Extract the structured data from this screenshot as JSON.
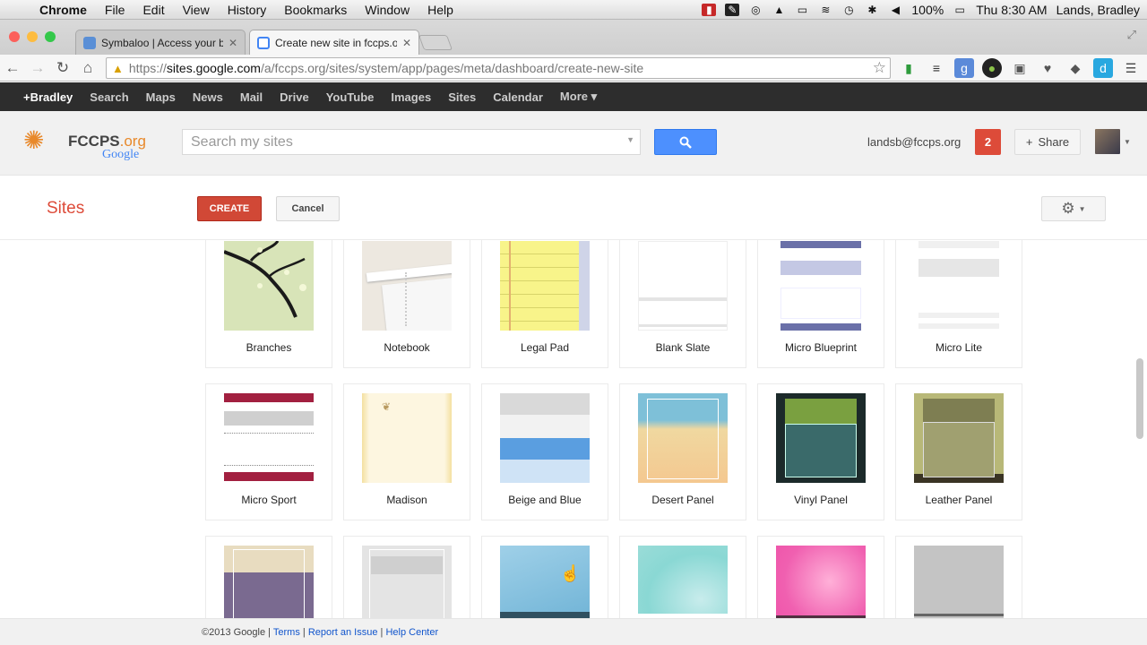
{
  "menubar": {
    "app": "Chrome",
    "items": [
      "File",
      "Edit",
      "View",
      "History",
      "Bookmarks",
      "Window",
      "Help"
    ],
    "battery": "100%",
    "clock": "Thu 8:30 AM",
    "user": "Lands, Bradley"
  },
  "tabs": [
    {
      "title": "Symbaloo | Access your bo",
      "active": false
    },
    {
      "title": "Create new site in fccps.or",
      "active": true
    }
  ],
  "omnibox": {
    "proto": "https://",
    "host": "sites.google.com",
    "path": "/a/fccps.org/sites/system/app/pages/meta/dashboard/create-new-site"
  },
  "gbar": {
    "items": [
      "+Bradley",
      "Search",
      "Maps",
      "News",
      "Mail",
      "Drive",
      "YouTube",
      "Images",
      "Sites",
      "Calendar",
      "More ▾"
    ]
  },
  "header": {
    "logo_main": "FCCPS",
    "logo_org": ".org",
    "logo_google": "Google",
    "search_placeholder": "Search my sites",
    "account": "landsb@fccps.org",
    "notifications": "2",
    "share": "Share"
  },
  "actions": {
    "title": "Sites",
    "create": "CREATE",
    "cancel": "Cancel"
  },
  "themes": [
    {
      "name": "Branches"
    },
    {
      "name": "Notebook"
    },
    {
      "name": "Legal Pad"
    },
    {
      "name": "Blank Slate"
    },
    {
      "name": "Micro Blueprint"
    },
    {
      "name": "Micro Lite"
    },
    {
      "name": "Micro Sport"
    },
    {
      "name": "Madison"
    },
    {
      "name": "Beige and Blue"
    },
    {
      "name": "Desert Panel"
    },
    {
      "name": "Vinyl Panel"
    },
    {
      "name": "Leather Panel"
    },
    {
      "name": ""
    },
    {
      "name": ""
    },
    {
      "name": ""
    },
    {
      "name": ""
    },
    {
      "name": ""
    },
    {
      "name": ""
    }
  ],
  "footer": {
    "copyright": "©2013 Google | ",
    "terms": "Terms",
    "report": "Report an Issue",
    "help": "Help Center",
    "sep": " | "
  },
  "colors": {
    "accent_red": "#dd4b39",
    "blue_button": "#4d90fe",
    "gbar_bg": "#2d2d2d"
  }
}
